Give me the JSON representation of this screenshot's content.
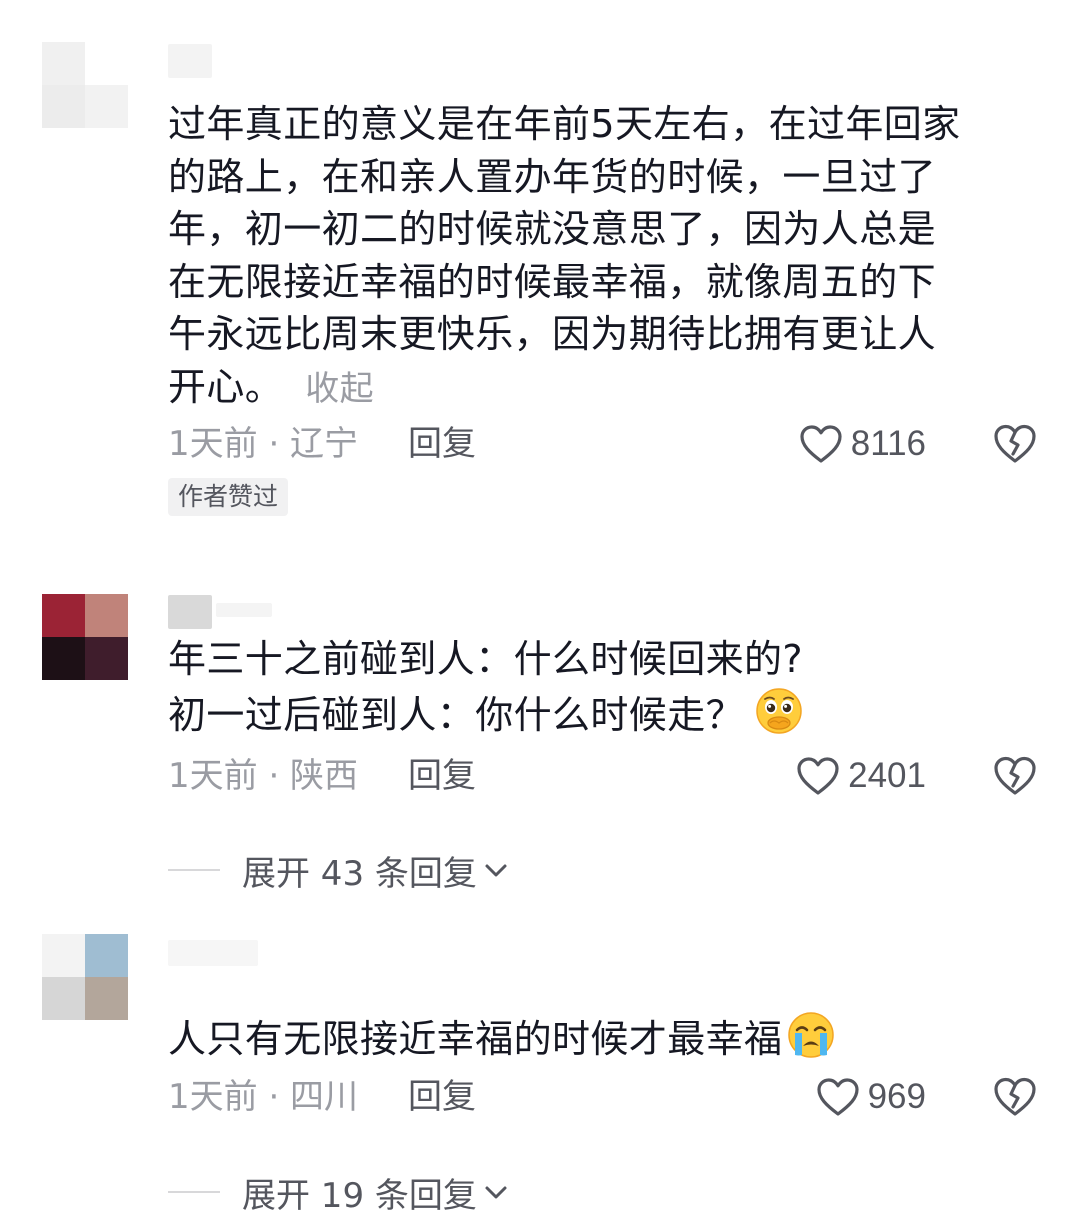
{
  "comments": [
    {
      "lines": [
        "过年真正的意义是在年前5天左右，在过年回家",
        "的路上，在和亲人置办年货的时候，一旦过了",
        "年，初一初二的时候就没意思了，因为人总是",
        "在无限接近幸福的时候最幸福，就像周五的下",
        "午永远比周末更快乐，因为期待比拥有更让人",
        "开心。"
      ],
      "collapse_label": "收起",
      "time_location": "1天前 · 辽宁",
      "reply_label": "回复",
      "like_count": "8116",
      "badge": "作者赞过",
      "avatar_colors": [
        "#f0f0f0",
        "#ffffff",
        "#ececec",
        "#f2f2f2"
      ],
      "icons": {
        "like": "heart-outline-icon",
        "dislike": "broken-heart-icon"
      }
    },
    {
      "lines": [
        "年三十之前碰到人：什么时候回来的?",
        "初一过后碰到人：你什么时候走？"
      ],
      "emoji": "pleading-face-emoji",
      "time_location": "1天前 · 陕西",
      "reply_label": "回复",
      "like_count": "2401",
      "expand_label": "展开 43 条回复",
      "avatar_colors": [
        "#9b2335",
        "#c0837a",
        "#1d1016",
        "#3f1d2c"
      ],
      "icons": {
        "like": "heart-outline-icon",
        "dislike": "broken-heart-icon"
      }
    },
    {
      "lines": [
        "人只有无限接近幸福的时候才最幸福"
      ],
      "emoji": "crying-face-emoji",
      "time_location": "1天前 · 四川",
      "reply_label": "回复",
      "like_count": "969",
      "expand_label": "展开 19 条回复",
      "avatar_colors": [
        "#f3f3f3",
        "#9fbdd2",
        "#d6d6d6",
        "#b3a69b"
      ],
      "icons": {
        "like": "heart-outline-icon",
        "dislike": "broken-heart-icon"
      }
    }
  ]
}
